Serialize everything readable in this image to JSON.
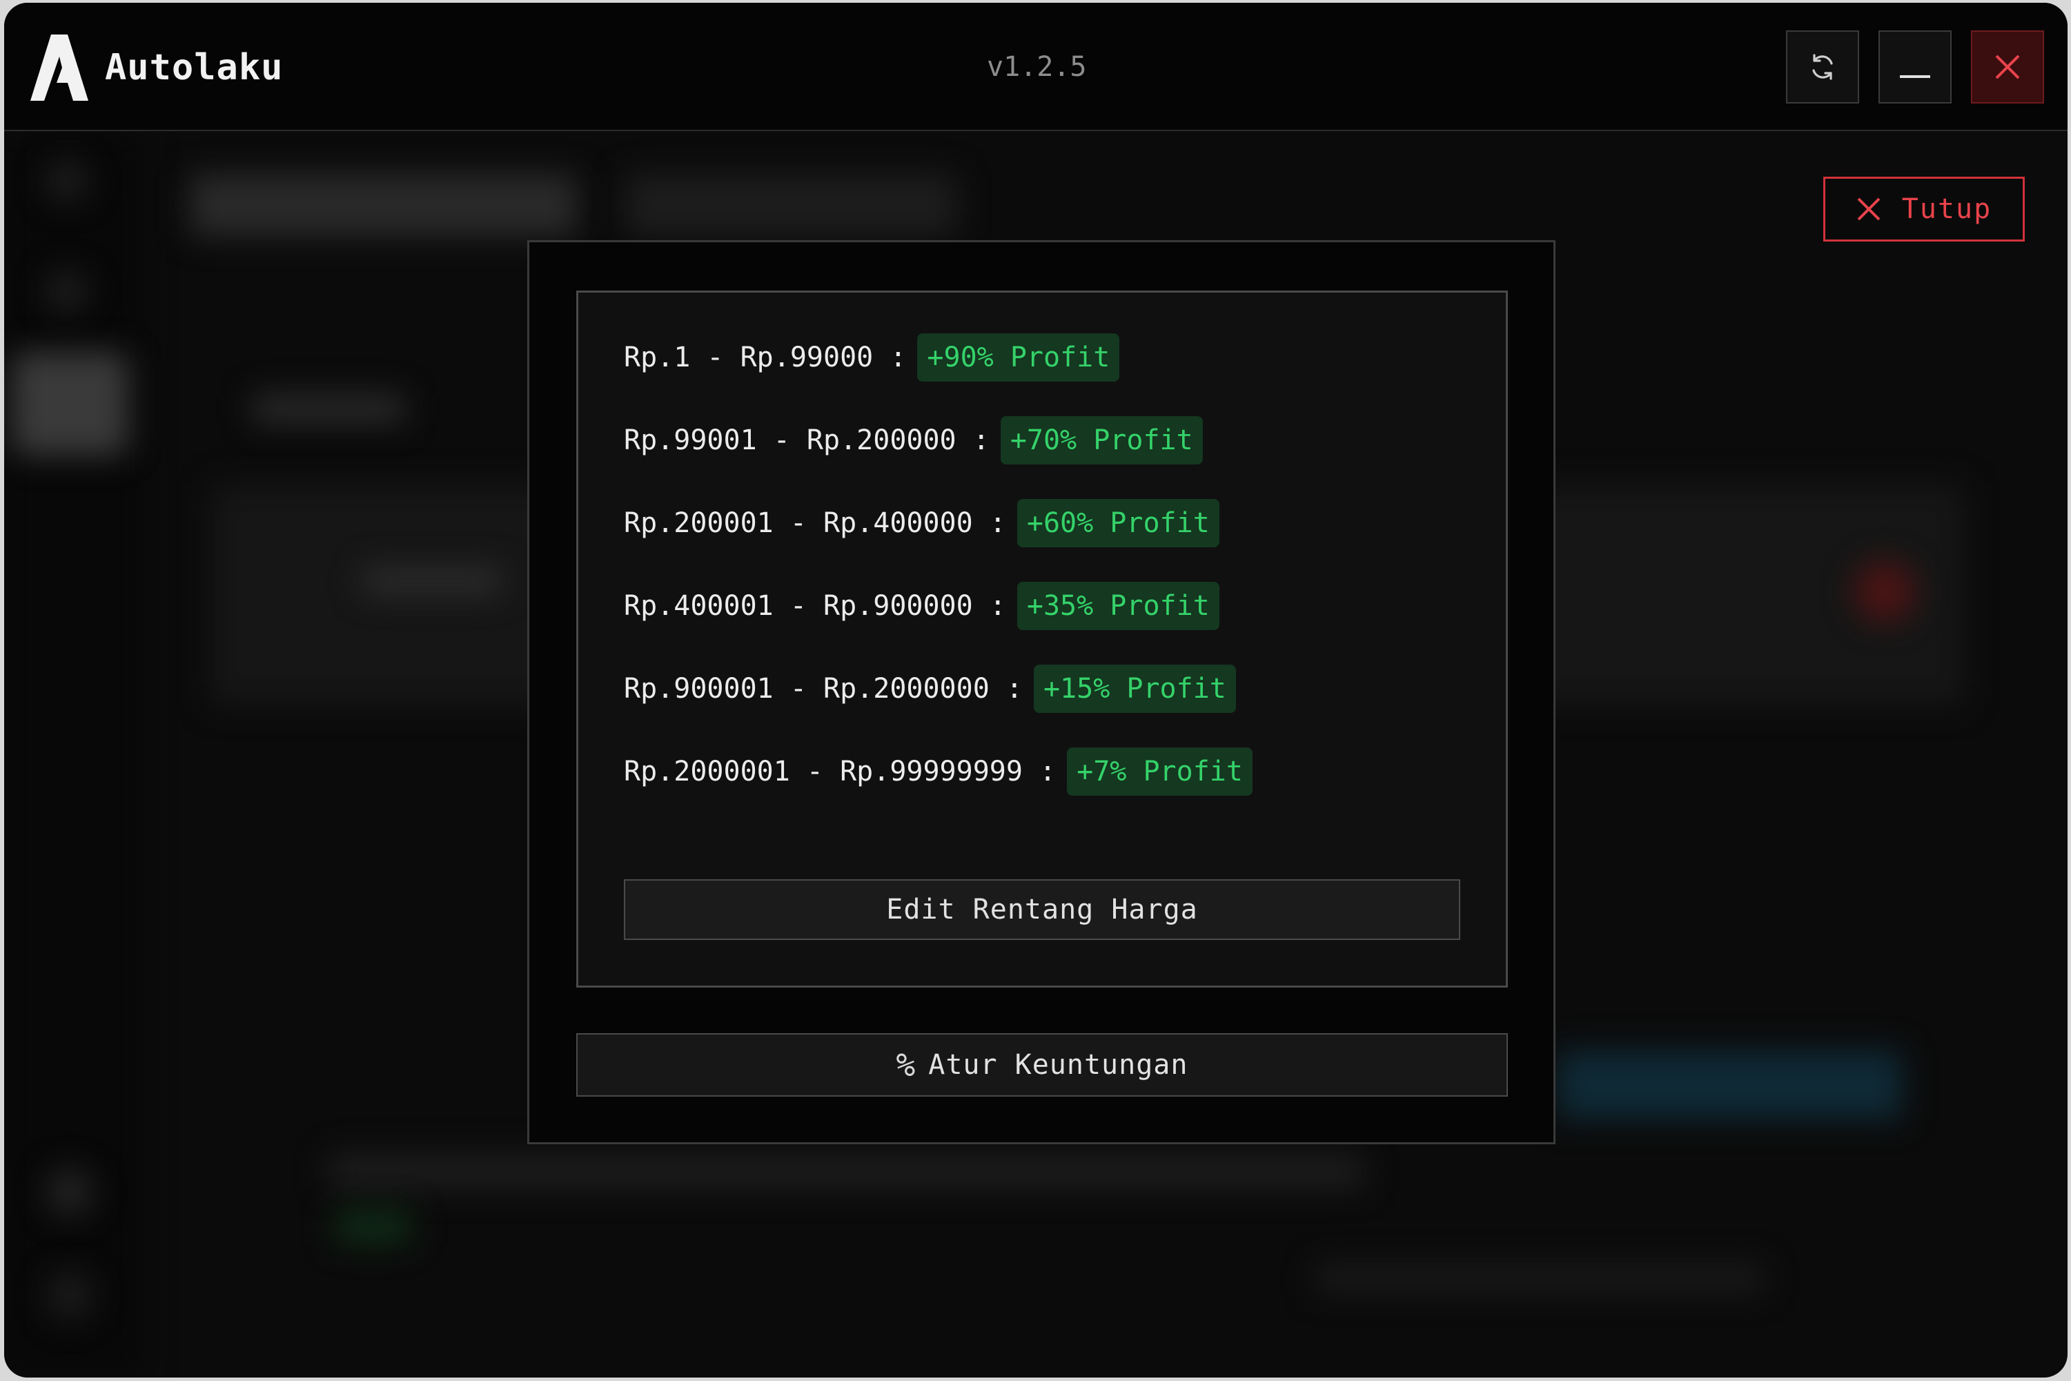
{
  "app": {
    "title": "Autolaku",
    "version": "v1.2.5"
  },
  "titlebar": {
    "buttons": [
      "refresh-icon",
      "minimize-icon",
      "close-icon"
    ],
    "close_color": "#e8434b"
  },
  "close_panel": {
    "label": "Tutup",
    "icon": "close-icon"
  },
  "profit_ranges": [
    {
      "range": "Rp.1 - Rp.99000 :",
      "badge": "+90% Profit"
    },
    {
      "range": "Rp.99001 - Rp.200000 :",
      "badge": "+70% Profit"
    },
    {
      "range": "Rp.200001 - Rp.400000 :",
      "badge": "+60% Profit"
    },
    {
      "range": "Rp.400001 - Rp.900000 :",
      "badge": "+35% Profit"
    },
    {
      "range": "Rp.900001 - Rp.2000000 :",
      "badge": "+15% Profit"
    },
    {
      "range": "Rp.2000001 - Rp.99999999 :",
      "badge": "+7% Profit"
    }
  ],
  "actions": {
    "edit_label": "Edit Rentang Harga",
    "atur_icon": "%",
    "atur_label": "Atur Keuntungan"
  },
  "colors": {
    "accent_green": "#35d26a",
    "badge_bg": "#143820",
    "danger_red": "#e8434b"
  }
}
